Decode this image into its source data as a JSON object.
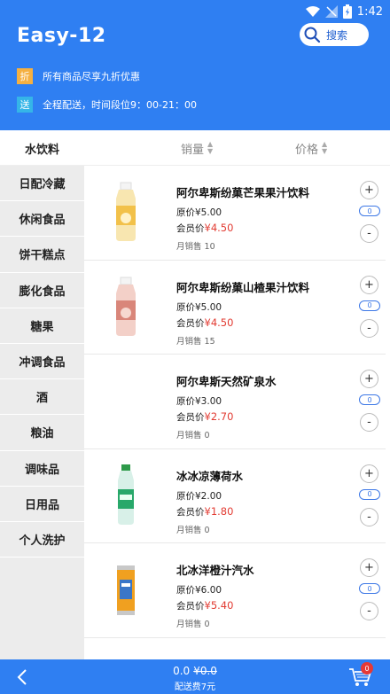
{
  "status": {
    "time": "1:42"
  },
  "header": {
    "title": "Easy-12",
    "search_label": "搜索"
  },
  "promos": [
    {
      "tag": "折",
      "text": "所有商品尽享九折优惠"
    },
    {
      "tag": "送",
      "text": "全程配送，时间段位9：00-21：00"
    }
  ],
  "sortbar": {
    "current_category": "水饮料",
    "sales": "销量",
    "price": "价格"
  },
  "sidebar": {
    "items": [
      "日配冷藏",
      "休闲食品",
      "饼干糕点",
      "膨化食品",
      "糖果",
      "冲调食品",
      "酒",
      "粮油",
      "调味品",
      "日用品",
      "个人洗护"
    ]
  },
  "products": [
    {
      "name": "阿尔卑斯纷菓芒果果汁饮料",
      "orig_label": "原价",
      "orig": "¥5.00",
      "member_label": "会员价",
      "member": "¥4.50",
      "monthly": "月销售 10",
      "qty": "0",
      "image": "mango-juice-bottle"
    },
    {
      "name": "阿尔卑斯纷菓山楂果汁饮料",
      "orig_label": "原价",
      "orig": "¥5.00",
      "member_label": "会员价",
      "member": "¥4.50",
      "monthly": "月销售 15",
      "qty": "0",
      "image": "hawthorn-juice-bottle"
    },
    {
      "name": "阿尔卑斯天然矿泉水",
      "orig_label": "原价",
      "orig": "¥3.00",
      "member_label": "会员价",
      "member": "¥2.70",
      "monthly": "月销售 0",
      "qty": "0",
      "image": ""
    },
    {
      "name": "冰冰凉薄荷水",
      "orig_label": "原价",
      "orig": "¥2.00",
      "member_label": "会员价",
      "member": "¥1.80",
      "monthly": "月销售 0",
      "qty": "0",
      "image": "mint-water-bottle"
    },
    {
      "name": "北冰洋橙汁汽水",
      "orig_label": "原价",
      "orig": "¥6.00",
      "member_label": "会员价",
      "member": "¥5.40",
      "monthly": "月销售 0",
      "qty": "0",
      "image": "orange-soda-can"
    }
  ],
  "controls": {
    "plus": "+",
    "minus": "-"
  },
  "footer": {
    "total": "0.0",
    "original_total": "¥0.0",
    "delivery": "配送费7元",
    "cart_count": "0"
  },
  "colors": {
    "brand_blue": "#2f7ff2",
    "price_red": "#e23b32",
    "promo_orange": "#f5b041",
    "promo_cyan": "#35b5e8"
  }
}
